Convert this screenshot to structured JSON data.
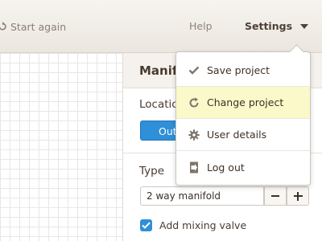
{
  "topbar": {
    "start_again_label": "Start again",
    "help_label": "Help",
    "settings_label": "Settings"
  },
  "panel": {
    "title": "Manif",
    "location_label": "Locatio",
    "location_button_label": "Out",
    "type_label": "Type",
    "type_value": "2 way manifold",
    "stepper_minus": "−",
    "stepper_plus": "+",
    "mixing_valve_label": "Add mixing valve",
    "mixing_valve_checked": true
  },
  "settings_menu": {
    "items": [
      {
        "label": "Save project",
        "icon": "check-icon"
      },
      {
        "label": "Change project",
        "icon": "refresh-icon",
        "highlighted": true
      },
      {
        "label": "User details",
        "icon": "gear-icon"
      },
      {
        "label": "Log out",
        "icon": "logout-icon"
      }
    ]
  },
  "colors": {
    "accent": "#2f8fd8",
    "highlight": "#fbf8c9",
    "text_dark": "#4a3b30",
    "topbar_bg": "#efeae4"
  }
}
